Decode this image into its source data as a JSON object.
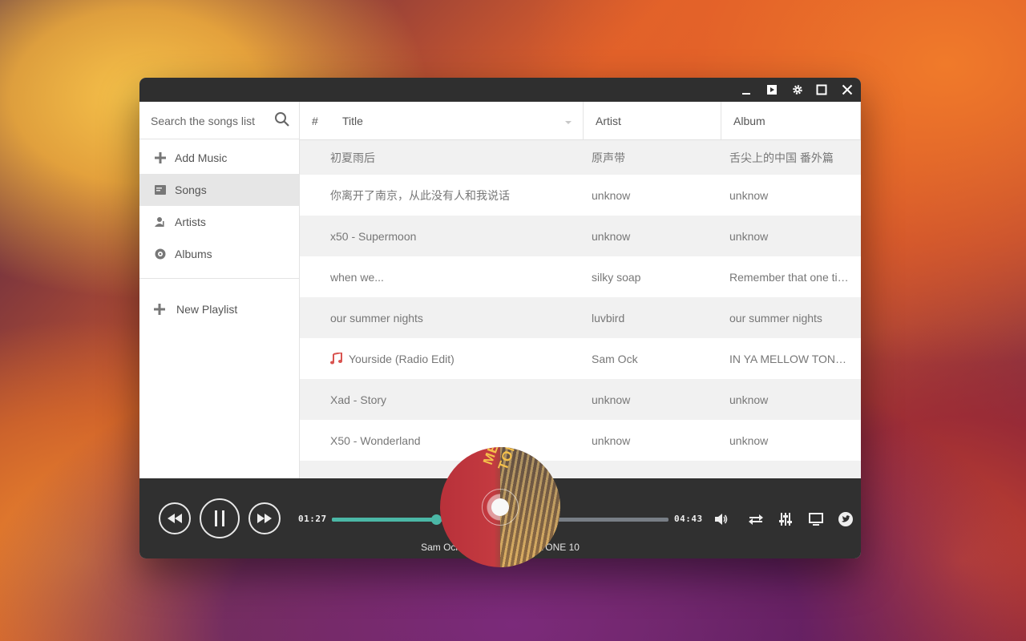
{
  "window": {
    "controls": [
      "minimize-icon",
      "mini-player-icon",
      "gear-icon",
      "maximize-icon",
      "close-icon"
    ]
  },
  "sidebar": {
    "search_placeholder": "Search the songs list",
    "items": [
      {
        "label": "Add Music",
        "icon": "plus-icon"
      },
      {
        "label": "Songs",
        "icon": "songs-icon",
        "active": true
      },
      {
        "label": "Artists",
        "icon": "artist-icon"
      },
      {
        "label": "Albums",
        "icon": "album-icon"
      }
    ],
    "new_playlist": "New Playlist"
  },
  "table": {
    "headers": {
      "num": "#",
      "title": "Title",
      "artist": "Artist",
      "album": "Album"
    },
    "rows": [
      {
        "title": "初夏雨后",
        "artist": "原声带",
        "album": "舌尖上的中国 番外篇"
      },
      {
        "title": "你离开了南京，从此没有人和我说话",
        "artist": "unknow",
        "album": "unknow"
      },
      {
        "title": "x50 - Supermoon",
        "artist": "unknow",
        "album": "unknow"
      },
      {
        "title": "when we...",
        "artist": "silky soap",
        "album": "Remember that one time..."
      },
      {
        "title": "our summer nights",
        "artist": "luvbird",
        "album": "our summer nights"
      },
      {
        "title": "Yourside (Radio Edit)",
        "artist": "Sam Ock",
        "album": "IN YA MELLOW TONE 10",
        "playing": true
      },
      {
        "title": "Xad - Story",
        "artist": "unknow",
        "album": "unknow"
      },
      {
        "title": "X50 - Wonderland",
        "artist": "unknow",
        "album": "unknow"
      }
    ]
  },
  "player": {
    "elapsed": "01:27",
    "duration": "04:43",
    "progress": 0.31,
    "now_playing_title": "Yourside (Radio Edit)",
    "now_playing_sub": "Sam Ock - IN YA MELLOW TONE 10",
    "album_art_text": "MELLOW TON",
    "accent": "#4bb7a6",
    "right_icons": [
      "volume-icon",
      "repeat-icon",
      "equalizer-icon",
      "screen-icon",
      "twitter-icon"
    ]
  }
}
